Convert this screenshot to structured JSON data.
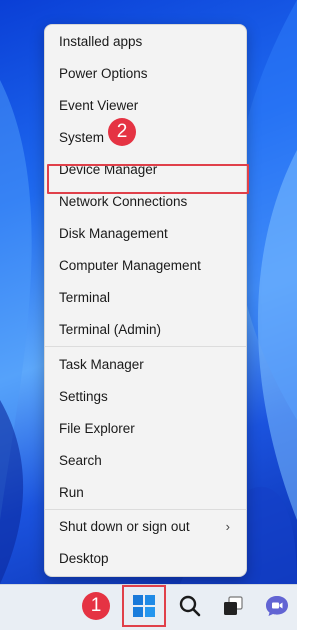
{
  "menu": {
    "items": [
      {
        "label": "Installed apps"
      },
      {
        "label": "Power Options"
      },
      {
        "label": "Event Viewer"
      },
      {
        "label": "System"
      },
      {
        "label": "Device Manager"
      },
      {
        "label": "Network Connections"
      },
      {
        "label": "Disk Management"
      },
      {
        "label": "Computer Management"
      },
      {
        "label": "Terminal"
      },
      {
        "label": "Terminal (Admin)"
      },
      {
        "label": "Task Manager"
      },
      {
        "label": "Settings"
      },
      {
        "label": "File Explorer"
      },
      {
        "label": "Search"
      },
      {
        "label": "Run"
      },
      {
        "label": "Shut down or sign out"
      },
      {
        "label": "Desktop"
      }
    ],
    "submenu_arrow": "›"
  },
  "annotations": {
    "step1": "1",
    "step2": "2",
    "color": "#e53343"
  },
  "taskbar": {
    "icons": [
      "windows-start-icon",
      "search-icon",
      "task-view-icon",
      "teams-chat-icon"
    ]
  }
}
